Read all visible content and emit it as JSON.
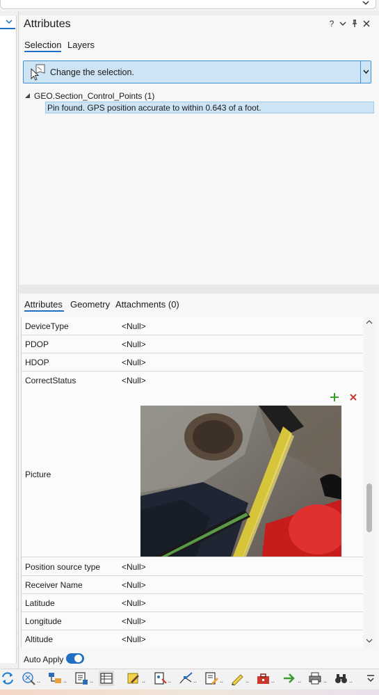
{
  "pane": {
    "title": "Attributes",
    "help_label": "?",
    "tabs": [
      {
        "label": "Selection",
        "active": true
      },
      {
        "label": "Layers",
        "active": false
      }
    ],
    "selection_prompt": "Change the selection.",
    "tree": {
      "layer_label": "GEO.Section_Control_Points  (1)",
      "feature_label": "Pin found.  GPS position accurate to within 0.643 of a foot."
    },
    "detail_tabs": [
      {
        "label": "Attributes",
        "active": true
      },
      {
        "label": "Geometry",
        "active": false
      },
      {
        "label": "Attachments (0)",
        "active": false
      }
    ],
    "rows_top": [
      {
        "field": "DeviceType",
        "value": "<Null>"
      },
      {
        "field": "PDOP",
        "value": "<Null>"
      },
      {
        "field": "HDOP",
        "value": "<Null>"
      },
      {
        "field": "CorrectStatus",
        "value": "<Null>"
      }
    ],
    "picture_field": "Picture",
    "rows_bottom": [
      {
        "field": "Position source type",
        "value": "<Null>"
      },
      {
        "field": "Receiver Name",
        "value": "<Null>"
      },
      {
        "field": "Latitude",
        "value": "<Null>"
      },
      {
        "field": "Longitude",
        "value": "<Null>"
      },
      {
        "field": "Altitude",
        "value": "<Null>"
      }
    ],
    "auto_apply_label": "Auto Apply",
    "auto_apply_on": true
  },
  "colors": {
    "accent": "#1f6fc5",
    "selection_fill": "#cde4f4",
    "add_green": "#3c9a2e",
    "remove_red": "#c8382c"
  },
  "toolbar_icons": [
    "refresh-icon",
    "explore-icon",
    "select-by-location-icon",
    "attributes-table-icon",
    "attribute-view-icon",
    "edit-icon",
    "create-features-icon",
    "modify-features-icon",
    "edit-attributes-icon",
    "annotate-icon",
    "toolbox-icon",
    "next-icon",
    "print-icon",
    "find-icon",
    "more-icon"
  ]
}
